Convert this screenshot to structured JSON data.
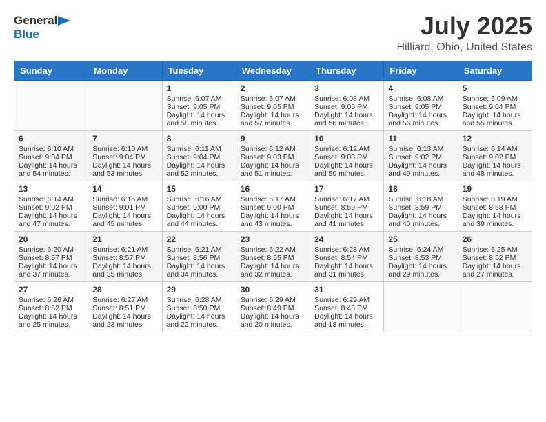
{
  "header": {
    "logo_general": "General",
    "logo_blue": "Blue",
    "title": "July 2025",
    "location": "Hilliard, Ohio, United States"
  },
  "calendar": {
    "days_of_week": [
      "Sunday",
      "Monday",
      "Tuesday",
      "Wednesday",
      "Thursday",
      "Friday",
      "Saturday"
    ],
    "weeks": [
      [
        {
          "day": "",
          "content": ""
        },
        {
          "day": "",
          "content": ""
        },
        {
          "day": "1",
          "content": "Sunrise: 6:07 AM\nSunset: 9:05 PM\nDaylight: 14 hours and 58 minutes."
        },
        {
          "day": "2",
          "content": "Sunrise: 6:07 AM\nSunset: 9:05 PM\nDaylight: 14 hours and 57 minutes."
        },
        {
          "day": "3",
          "content": "Sunrise: 6:08 AM\nSunset: 9:05 PM\nDaylight: 14 hours and 56 minutes."
        },
        {
          "day": "4",
          "content": "Sunrise: 6:08 AM\nSunset: 9:05 PM\nDaylight: 14 hours and 56 minutes."
        },
        {
          "day": "5",
          "content": "Sunrise: 6:09 AM\nSunset: 9:04 PM\nDaylight: 14 hours and 55 minutes."
        }
      ],
      [
        {
          "day": "6",
          "content": "Sunrise: 6:10 AM\nSunset: 9:04 PM\nDaylight: 14 hours and 54 minutes."
        },
        {
          "day": "7",
          "content": "Sunrise: 6:10 AM\nSunset: 9:04 PM\nDaylight: 14 hours and 53 minutes."
        },
        {
          "day": "8",
          "content": "Sunrise: 6:11 AM\nSunset: 9:04 PM\nDaylight: 14 hours and 52 minutes."
        },
        {
          "day": "9",
          "content": "Sunrise: 6:12 AM\nSunset: 9:03 PM\nDaylight: 14 hours and 51 minutes."
        },
        {
          "day": "10",
          "content": "Sunrise: 6:12 AM\nSunset: 9:03 PM\nDaylight: 14 hours and 50 minutes."
        },
        {
          "day": "11",
          "content": "Sunrise: 6:13 AM\nSunset: 9:02 PM\nDaylight: 14 hours and 49 minutes."
        },
        {
          "day": "12",
          "content": "Sunrise: 6:14 AM\nSunset: 9:02 PM\nDaylight: 14 hours and 48 minutes."
        }
      ],
      [
        {
          "day": "13",
          "content": "Sunrise: 6:14 AM\nSunset: 9:02 PM\nDaylight: 14 hours and 47 minutes."
        },
        {
          "day": "14",
          "content": "Sunrise: 6:15 AM\nSunset: 9:01 PM\nDaylight: 14 hours and 45 minutes."
        },
        {
          "day": "15",
          "content": "Sunrise: 6:16 AM\nSunset: 9:00 PM\nDaylight: 14 hours and 44 minutes."
        },
        {
          "day": "16",
          "content": "Sunrise: 6:17 AM\nSunset: 9:00 PM\nDaylight: 14 hours and 43 minutes."
        },
        {
          "day": "17",
          "content": "Sunrise: 6:17 AM\nSunset: 8:59 PM\nDaylight: 14 hours and 41 minutes."
        },
        {
          "day": "18",
          "content": "Sunrise: 6:18 AM\nSunset: 8:59 PM\nDaylight: 14 hours and 40 minutes."
        },
        {
          "day": "19",
          "content": "Sunrise: 6:19 AM\nSunset: 8:58 PM\nDaylight: 14 hours and 39 minutes."
        }
      ],
      [
        {
          "day": "20",
          "content": "Sunrise: 6:20 AM\nSunset: 8:57 PM\nDaylight: 14 hours and 37 minutes."
        },
        {
          "day": "21",
          "content": "Sunrise: 6:21 AM\nSunset: 8:57 PM\nDaylight: 14 hours and 35 minutes."
        },
        {
          "day": "22",
          "content": "Sunrise: 6:21 AM\nSunset: 8:56 PM\nDaylight: 14 hours and 34 minutes."
        },
        {
          "day": "23",
          "content": "Sunrise: 6:22 AM\nSunset: 8:55 PM\nDaylight: 14 hours and 32 minutes."
        },
        {
          "day": "24",
          "content": "Sunrise: 6:23 AM\nSunset: 8:54 PM\nDaylight: 14 hours and 31 minutes."
        },
        {
          "day": "25",
          "content": "Sunrise: 6:24 AM\nSunset: 8:53 PM\nDaylight: 14 hours and 29 minutes."
        },
        {
          "day": "26",
          "content": "Sunrise: 6:25 AM\nSunset: 8:52 PM\nDaylight: 14 hours and 27 minutes."
        }
      ],
      [
        {
          "day": "27",
          "content": "Sunrise: 6:26 AM\nSunset: 8:52 PM\nDaylight: 14 hours and 25 minutes."
        },
        {
          "day": "28",
          "content": "Sunrise: 6:27 AM\nSunset: 8:51 PM\nDaylight: 14 hours and 23 minutes."
        },
        {
          "day": "29",
          "content": "Sunrise: 6:28 AM\nSunset: 8:50 PM\nDaylight: 14 hours and 22 minutes."
        },
        {
          "day": "30",
          "content": "Sunrise: 6:29 AM\nSunset: 8:49 PM\nDaylight: 14 hours and 20 minutes."
        },
        {
          "day": "31",
          "content": "Sunrise: 6:29 AM\nSunset: 8:48 PM\nDaylight: 14 hours and 18 minutes."
        },
        {
          "day": "",
          "content": ""
        },
        {
          "day": "",
          "content": ""
        }
      ]
    ]
  }
}
